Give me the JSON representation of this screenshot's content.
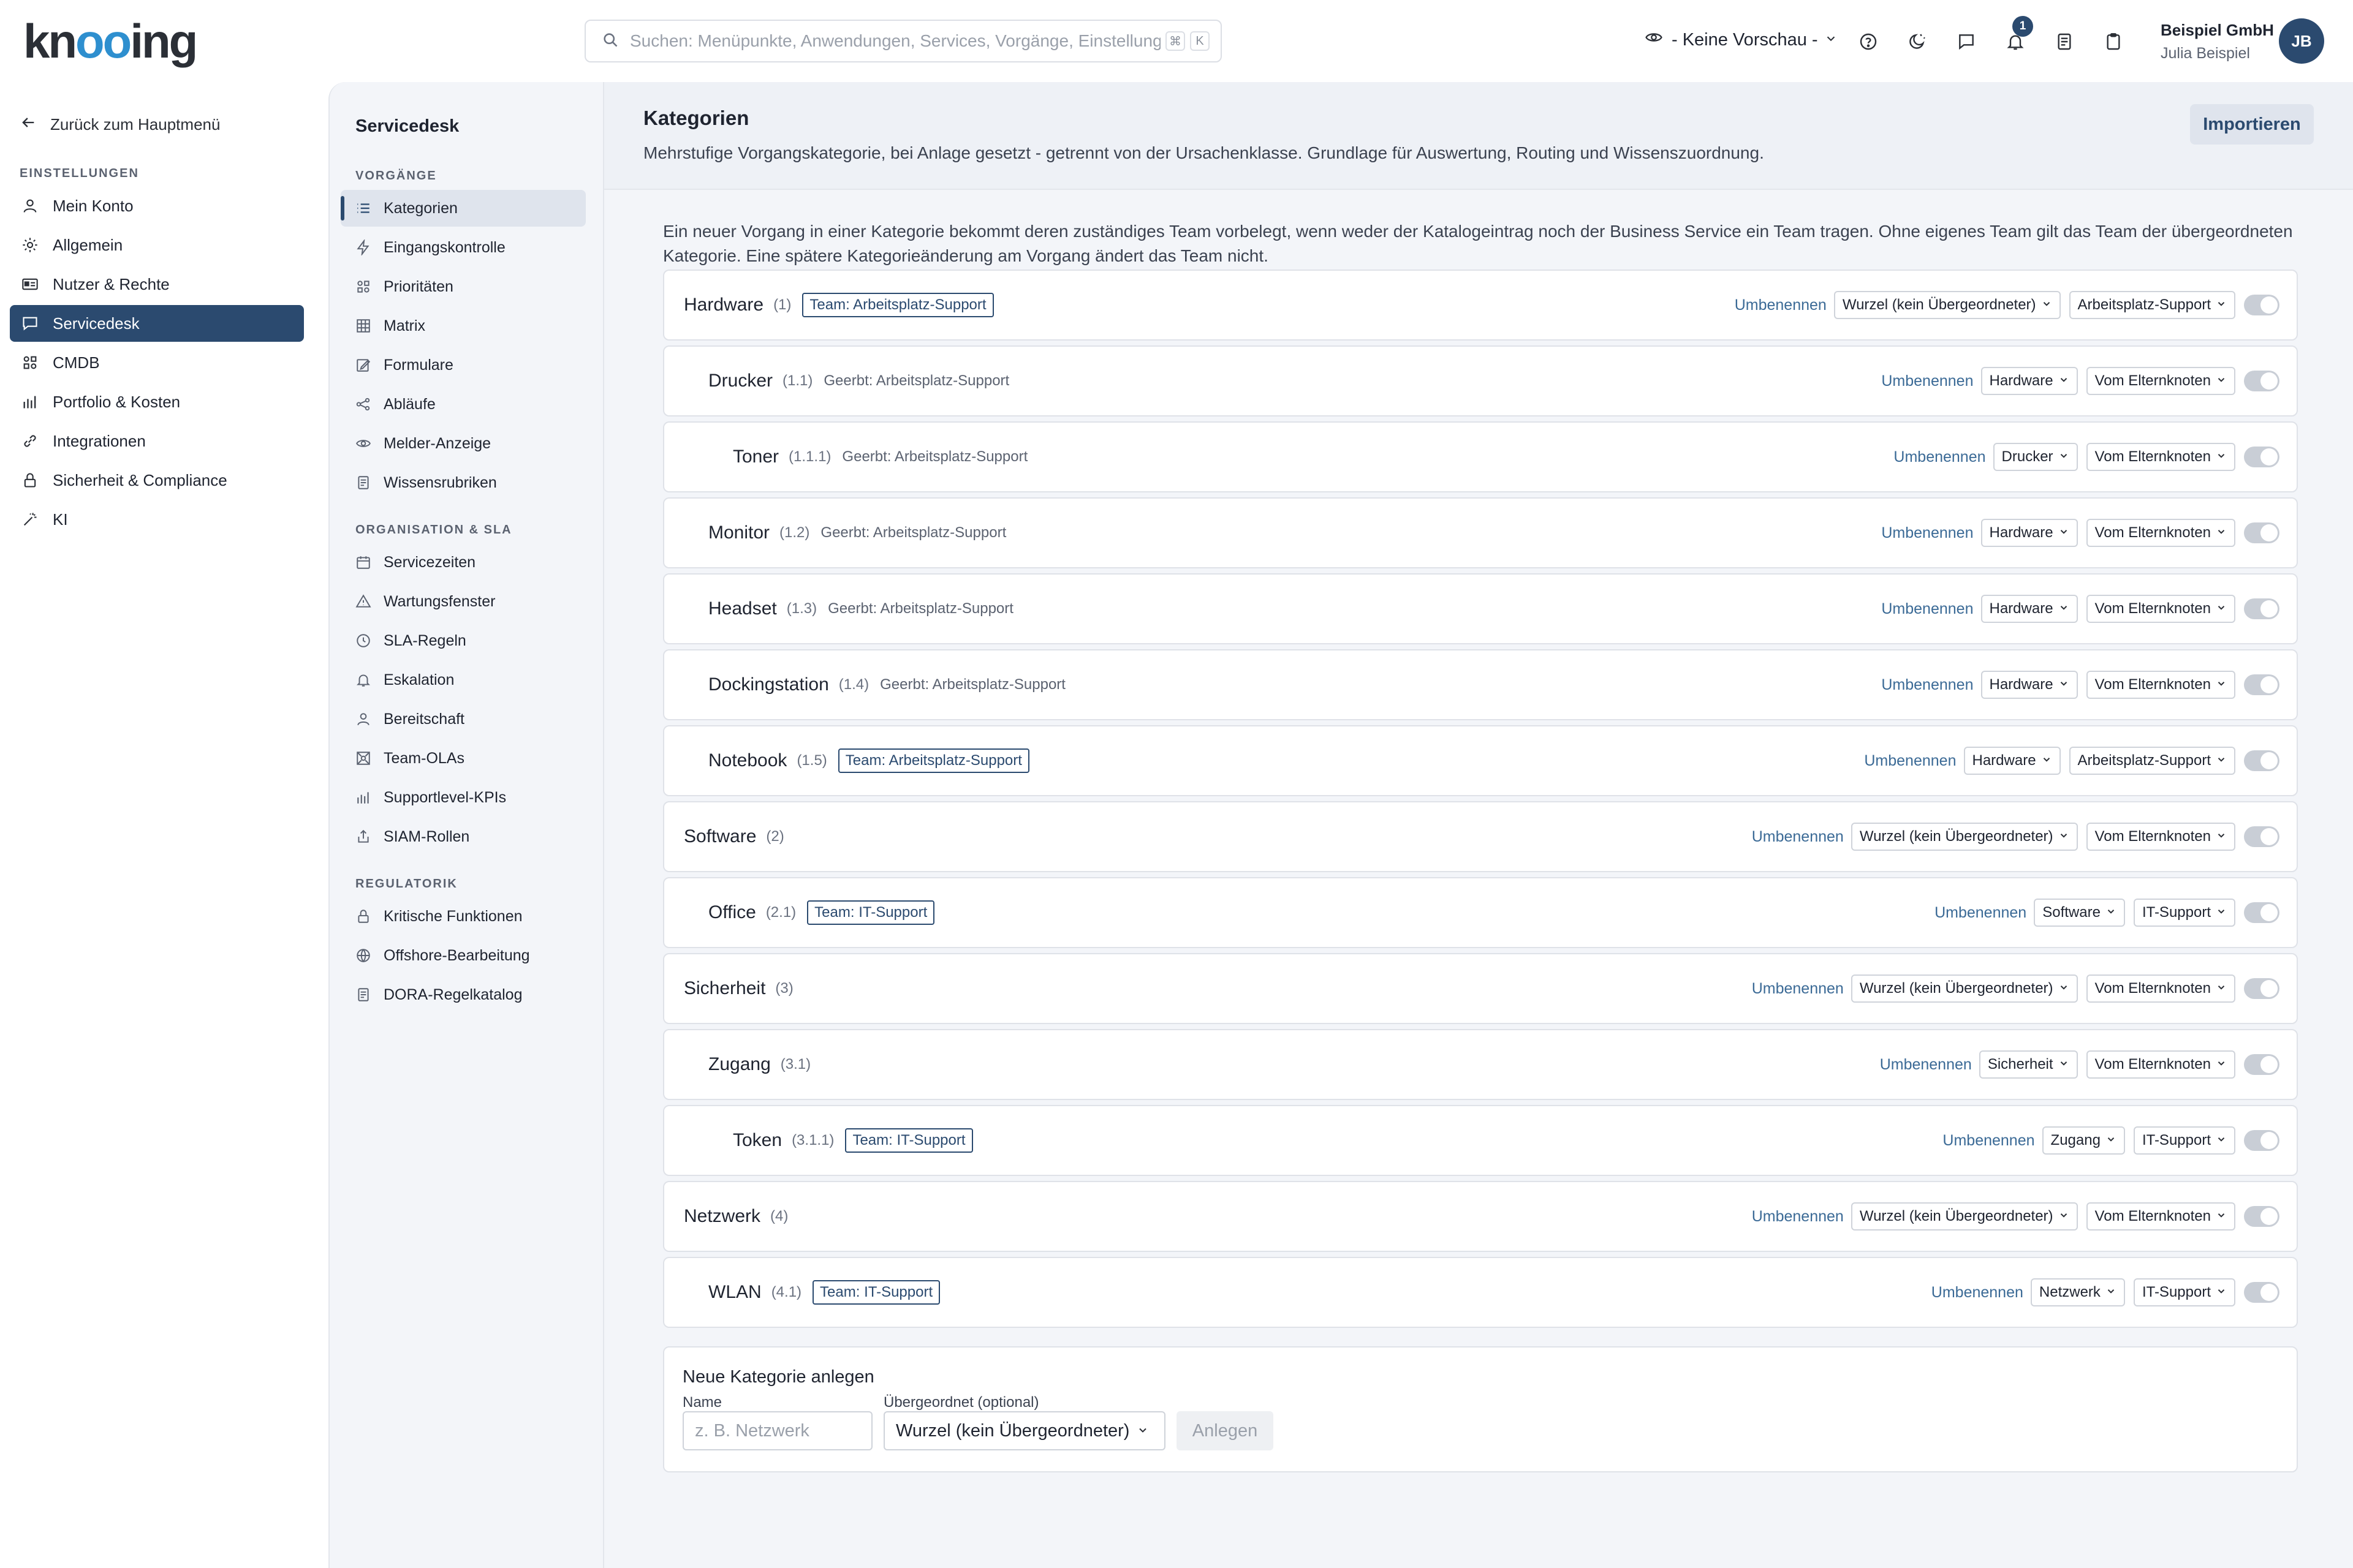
{
  "brand": {
    "logo_pre": "kn",
    "logo_mid": "oo",
    "logo_post": "ing"
  },
  "search": {
    "placeholder": "Suchen: Menüpunkte, Anwendungen, Services, Vorgänge, Einstellungen",
    "kbd1": "⌘",
    "kbd2": "K"
  },
  "preview": {
    "label": "- Keine Vorschau -"
  },
  "notifications": {
    "count": "1"
  },
  "user": {
    "company": "Beispiel GmbH",
    "name": "Julia Beispiel",
    "initials": "JB"
  },
  "leftnav": {
    "back_label": "Zurück zum Hauptmenü",
    "section": "EINSTELLUNGEN",
    "items": [
      {
        "label": "Mein Konto",
        "icon": "user-icon"
      },
      {
        "label": "Allgemein",
        "icon": "gear-icon"
      },
      {
        "label": "Nutzer & Rechte",
        "icon": "id-card-icon"
      },
      {
        "label": "Servicedesk",
        "icon": "chat-icon"
      },
      {
        "label": "CMDB",
        "icon": "grid-icon"
      },
      {
        "label": "Portfolio & Kosten",
        "icon": "bar-chart-icon"
      },
      {
        "label": "Integrationen",
        "icon": "link-icon"
      },
      {
        "label": "Sicherheit & Compliance",
        "icon": "lock-icon"
      },
      {
        "label": "KI",
        "icon": "magic-wand-icon"
      }
    ]
  },
  "subnav": {
    "title": "Servicedesk",
    "groups": [
      {
        "heading": "VORGÄNGE",
        "items": [
          "Kategorien",
          "Eingangskontrolle",
          "Prioritäten",
          "Matrix",
          "Formulare",
          "Abläufe",
          "Melder-Anzeige",
          "Wissensrubriken"
        ]
      },
      {
        "heading": "ORGANISATION & SLA",
        "items": [
          "Servicezeiten",
          "Wartungsfenster",
          "SLA-Regeln",
          "Eskalation",
          "Bereitschaft",
          "Team-OLAs",
          "Supportlevel-KPIs",
          "SIAM-Rollen"
        ]
      },
      {
        "heading": "REGULATORIK",
        "items": [
          "Kritische Funktionen",
          "Offshore-Bearbeitung",
          "DORA-Regelkatalog"
        ]
      }
    ]
  },
  "main": {
    "title": "Kategorien",
    "subtitle": "Mehrstufige Vorgangskategorie, bei Anlage gesetzt - getrennt von der Ursachenklasse. Grundlage für Auswertung, Routing und Wissenszuordnung.",
    "import_label": "Importieren",
    "intro": "Ein neuer Vorgang in einer Kategorie bekommt deren zuständiges Team vorbelegt, wenn weder der Katalogeintrag noch der Business Service ein Team tragen. Ohne eigenes Team gilt das Team der übergeordneten Kategorie. Eine spätere Kategorieänderung am Vorgang ändert das Team nicht.",
    "rename_label": "Umbenennen",
    "categories": [
      {
        "name": "Hardware",
        "code": "(1)",
        "team": "Team: Arbeitsplatz-Support",
        "inherited": "",
        "parent": "Wurzel (kein Übergeordneter)",
        "team_select": "Arbeitsplatz-Support"
      },
      {
        "name": "Drucker",
        "code": "(1.1)",
        "team": "",
        "inherited": "Geerbt: Arbeitsplatz-Support",
        "parent": "Hardware",
        "team_select": "Vom Elternknoten"
      },
      {
        "name": "Toner",
        "code": "(1.1.1)",
        "team": "",
        "inherited": "Geerbt: Arbeitsplatz-Support",
        "parent": "Drucker",
        "team_select": "Vom Elternknoten"
      },
      {
        "name": "Monitor",
        "code": "(1.2)",
        "team": "",
        "inherited": "Geerbt: Arbeitsplatz-Support",
        "parent": "Hardware",
        "team_select": "Vom Elternknoten"
      },
      {
        "name": "Headset",
        "code": "(1.3)",
        "team": "",
        "inherited": "Geerbt: Arbeitsplatz-Support",
        "parent": "Hardware",
        "team_select": "Vom Elternknoten"
      },
      {
        "name": "Dockingstation",
        "code": "(1.4)",
        "team": "",
        "inherited": "Geerbt: Arbeitsplatz-Support",
        "parent": "Hardware",
        "team_select": "Vom Elternknoten"
      },
      {
        "name": "Notebook",
        "code": "(1.5)",
        "team": "Team: Arbeitsplatz-Support",
        "inherited": "",
        "parent": "Hardware",
        "team_select": "Arbeitsplatz-Support"
      },
      {
        "name": "Software",
        "code": "(2)",
        "team": "",
        "inherited": "",
        "parent": "Wurzel (kein Übergeordneter)",
        "team_select": "Vom Elternknoten"
      },
      {
        "name": "Office",
        "code": "(2.1)",
        "team": "Team: IT-Support",
        "inherited": "",
        "parent": "Software",
        "team_select": "IT-Support"
      },
      {
        "name": "Sicherheit",
        "code": "(3)",
        "team": "",
        "inherited": "",
        "parent": "Wurzel (kein Übergeordneter)",
        "team_select": "Vom Elternknoten"
      },
      {
        "name": "Zugang",
        "code": "(3.1)",
        "team": "",
        "inherited": "",
        "parent": "Sicherheit",
        "team_select": "Vom Elternknoten"
      },
      {
        "name": "Token",
        "code": "(3.1.1)",
        "team": "Team: IT-Support",
        "inherited": "",
        "parent": "Zugang",
        "team_select": "IT-Support"
      },
      {
        "name": "Netzwerk",
        "code": "(4)",
        "team": "",
        "inherited": "",
        "parent": "Wurzel (kein Übergeordneter)",
        "team_select": "Vom Elternknoten"
      },
      {
        "name": "WLAN",
        "code": "(4.1)",
        "team": "Team: IT-Support",
        "inherited": "",
        "parent": "Netzwerk",
        "team_select": "IT-Support"
      }
    ],
    "new_category": {
      "title": "Neue Kategorie anlegen",
      "name_label": "Name",
      "name_placeholder": "z. B. Netzwerk",
      "parent_label": "Übergeordnet (optional)",
      "parent_value": "Wurzel (kein Übergeordneter)",
      "create_label": "Anlegen"
    }
  }
}
